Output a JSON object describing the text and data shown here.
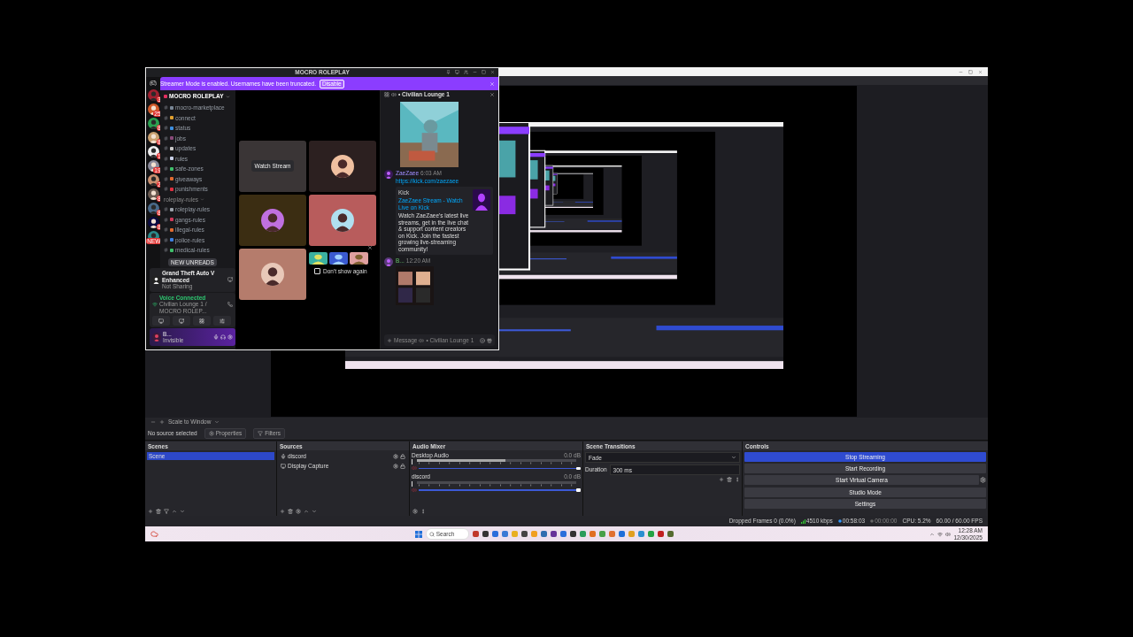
{
  "discord": {
    "title": "MOCRO ROLEPLAY",
    "banner": {
      "text": "Streamer Mode is enabled. Usernames have been truncated.",
      "button": "Disable"
    },
    "servers": [
      {
        "badge": "3"
      },
      {
        "badge": "25"
      },
      {
        "badge": "8"
      },
      {
        "badge": "8"
      },
      {
        "badge": "1"
      },
      {
        "badge": "19"
      },
      {
        "badge": "2"
      },
      {
        "badge": "8"
      },
      {
        "badge": "8"
      },
      {
        "badge": "8"
      },
      {
        "badge": "NEW"
      }
    ],
    "server_name": "MOCRO ROLEPLAY",
    "channels": [
      {
        "kind": "channel",
        "name": "mocro-marketplace",
        "color": "#7a8796"
      },
      {
        "kind": "channel",
        "name": "connect",
        "color": "#e0a030"
      },
      {
        "kind": "channel",
        "name": "status",
        "color": "#3d8fe0"
      },
      {
        "kind": "channel",
        "name": "jobs",
        "color": "#8a4a7a"
      },
      {
        "kind": "channel",
        "name": "updates",
        "color": "#c8c8c8"
      },
      {
        "kind": "channel",
        "name": "rules",
        "color": "#c8d0e8"
      },
      {
        "kind": "channel",
        "name": "safe-zones",
        "color": "#3fbf6a"
      },
      {
        "kind": "channel",
        "name": "giveaways",
        "color": "#e06a30"
      },
      {
        "kind": "channel",
        "name": "punishments",
        "color": "#e03040"
      },
      {
        "kind": "category",
        "name": "roleplay-rules"
      },
      {
        "kind": "channel",
        "name": "roleplay-rules",
        "color": "#9aa0a8"
      },
      {
        "kind": "channel",
        "name": "gangs-rules",
        "color": "#d03a5a"
      },
      {
        "kind": "channel",
        "name": "illegal-rules",
        "color": "#e06a30"
      },
      {
        "kind": "channel",
        "name": "police-rules",
        "color": "#3d7fe0"
      },
      {
        "kind": "channel",
        "name": "medical-rules",
        "color": "#3fbf6a"
      }
    ],
    "unread_pill": "NEW UNREADS",
    "activity": {
      "title": "Grand Theft Auto V Enhanced",
      "status": "Not Sharing"
    },
    "voice": {
      "status": "Voice Connected",
      "channel": "Civilian Lounge 1 / MOCRO ROLEP..."
    },
    "user": {
      "name": "B...",
      "status": "Invisible"
    },
    "tiles": [
      {
        "kind": "stream",
        "label": "Watch Stream",
        "color": "#3a3536"
      },
      {
        "kind": "avatar",
        "color": "#2c2020"
      },
      {
        "kind": "avatar",
        "color": "#3b2d12"
      },
      {
        "kind": "avatar",
        "color": "#b85c5c"
      },
      {
        "kind": "avatar",
        "color": "#b57c6c"
      }
    ],
    "popup": {
      "label": "Don't show again",
      "checked": false
    },
    "chat": {
      "title": "• Civilian Lounge 1",
      "messages": [
        {
          "author": "ZaeZaee",
          "time": "6:03 AM",
          "link": "https://kick.com/zaezaee",
          "embed": {
            "provider": "Kick",
            "title": "ZaeZaee Stream - Watch Live on Kick",
            "description": "Watch ZaeZaee's latest live streams, get in the live chat & support content creators on Kick. Join the fastest growing live-streaming community!"
          }
        },
        {
          "author": "B...",
          "time": "12:20 AM"
        }
      ],
      "placeholder": "Message",
      "placeholder_channel": "• Civilian Lounge 1"
    }
  },
  "obs": {
    "toolbar": "Scale to Window",
    "source_bar": {
      "label": "No source selected",
      "buttons": [
        "Properties",
        "Filters"
      ]
    },
    "scenes": {
      "title": "Scenes",
      "items": [
        {
          "name": "Scene",
          "selected": true
        }
      ]
    },
    "sources": {
      "title": "Sources",
      "items": [
        {
          "kind": "audio",
          "name": "discord"
        },
        {
          "kind": "display",
          "name": "Display Capture"
        }
      ]
    },
    "mixer": {
      "title": "Audio Mixer",
      "channels": [
        {
          "name": "Desktop Audio",
          "reading": "0.0 dB",
          "level": 1
        },
        {
          "name": "discord",
          "reading": "0.0 dB",
          "level": 1
        }
      ]
    },
    "transitions": {
      "title": "Scene Transitions",
      "transition": "Fade",
      "duration_label": "Duration",
      "duration": "300 ms"
    },
    "controls": {
      "title": "Controls",
      "buttons": [
        {
          "label": "Stop Streaming",
          "active": true,
          "has_settings": false
        },
        {
          "label": "Start Recording",
          "active": false,
          "has_settings": false
        },
        {
          "label": "Start Virtual Camera",
          "active": false,
          "has_settings": true
        },
        {
          "label": "Studio Mode",
          "active": false,
          "has_settings": false
        },
        {
          "label": "Settings",
          "active": false,
          "has_settings": false
        }
      ]
    },
    "status": [
      "Dropped Frames 0 (0.0%)",
      "4510 kbps",
      "00:58:03",
      "00:00:00",
      "CPU: 5.2%",
      "60.00 / 60.00 FPS"
    ]
  },
  "taskbar": {
    "search": "Search",
    "time": "12:28 AM",
    "date": "12/30/2025"
  }
}
